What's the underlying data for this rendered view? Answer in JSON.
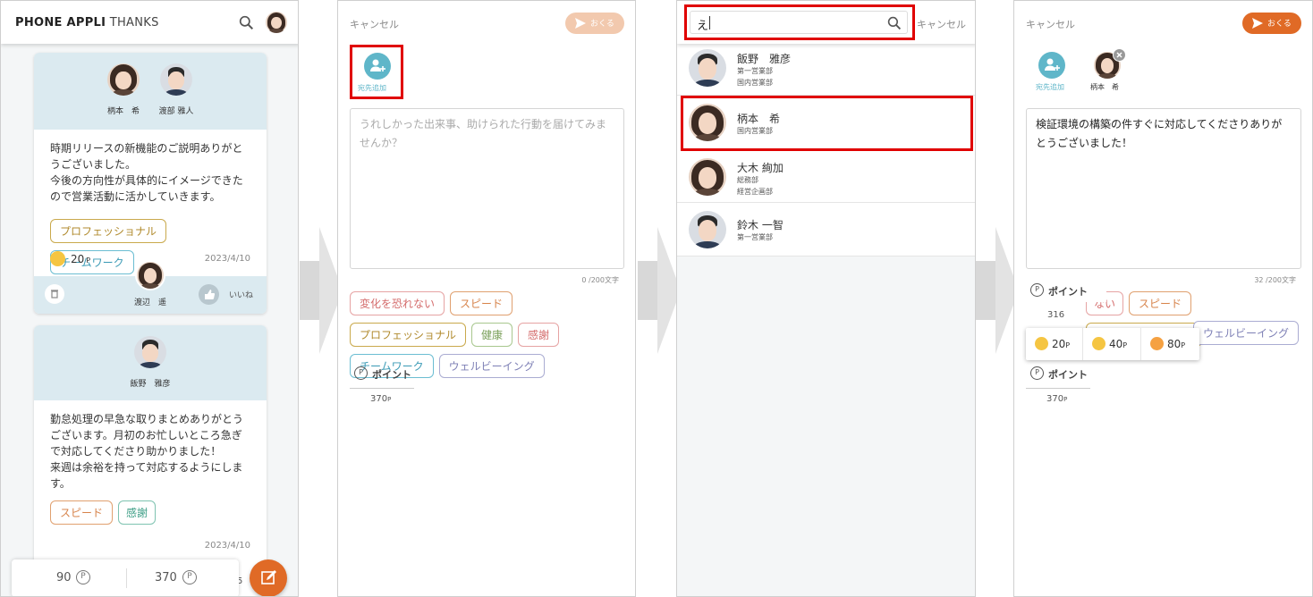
{
  "p1": {
    "brand_bold": "PHONE APPLI",
    "brand_light": "THANKS",
    "card1": {
      "recipients": [
        {
          "name": "柄本　希"
        },
        {
          "name": "渡部 雅人"
        }
      ],
      "message": "時期リリースの新機能のご説明ありがとうございました。\n今後の方向性が具体的にイメージできたので営業活動に活かしていきます。",
      "tags": [
        "プロフェッショナル",
        "チームワーク"
      ],
      "points": "20",
      "points_unit": "P",
      "date": "2023/4/10",
      "sender": "渡辺　遥",
      "like_label": "いいね"
    },
    "card2": {
      "recipient": "飯野　雅彦",
      "message": "勤怠処理の早急な取りまとめありがとうございます。月初のお忙しいところ急ぎで対応してくださり助かりました！\n来週は余裕を持って対応するようにします。",
      "tags": [
        "スピード",
        "感謝"
      ],
      "date": "2023/4/10"
    },
    "footer": {
      "received": "90",
      "remaining": "370",
      "extra": "5"
    }
  },
  "p2": {
    "cancel": "キャンセル",
    "send": "おくる",
    "add_label": "宛先追加",
    "placeholder": "うれしかった出来事、助けられた行動を届けてみませんか？",
    "counter": "0 /200文字",
    "tags": [
      "変化を恐れない",
      "スピード",
      "プロフェッショナル",
      "健康",
      "感謝",
      "チームワーク",
      "ウェルビーイング"
    ],
    "points_label": "ポイント",
    "points_value": "370",
    "points_unit": "P"
  },
  "p3": {
    "search_value": "え",
    "cancel": "キャンセル",
    "results": [
      {
        "name": "飯野　雅彦",
        "dept1": "第一営業部",
        "dept2": "国内営業部"
      },
      {
        "name": "柄本　希",
        "dept1": "国内営業部",
        "dept2": ""
      },
      {
        "name": "大木 絢加",
        "dept1": "総務部",
        "dept2": "経営企画部"
      },
      {
        "name": "鈴木 一智",
        "dept1": "第一営業部",
        "dept2": ""
      }
    ]
  },
  "p4": {
    "cancel": "キャンセル",
    "send": "おくる",
    "add_label": "宛先追加",
    "recipient": "柄本　希",
    "message": "検証環境の構築の件すぐに対応してくださりありがとうございました！",
    "counter": "32 /200文字",
    "tags": [
      "ない",
      "スピード",
      "プロフェッショナル",
      "ウェルビーイング"
    ],
    "points_label": "ポイント",
    "points_value_top": "316",
    "points_options": [
      "20",
      "40",
      "80"
    ],
    "points_unit": "P",
    "points_label2": "ポイント",
    "points_value": "370"
  },
  "colors": {
    "accent": "#e06a26",
    "teal": "#5fb6c9",
    "highlight": "#e00000",
    "card_head": "#dbeaf0"
  }
}
